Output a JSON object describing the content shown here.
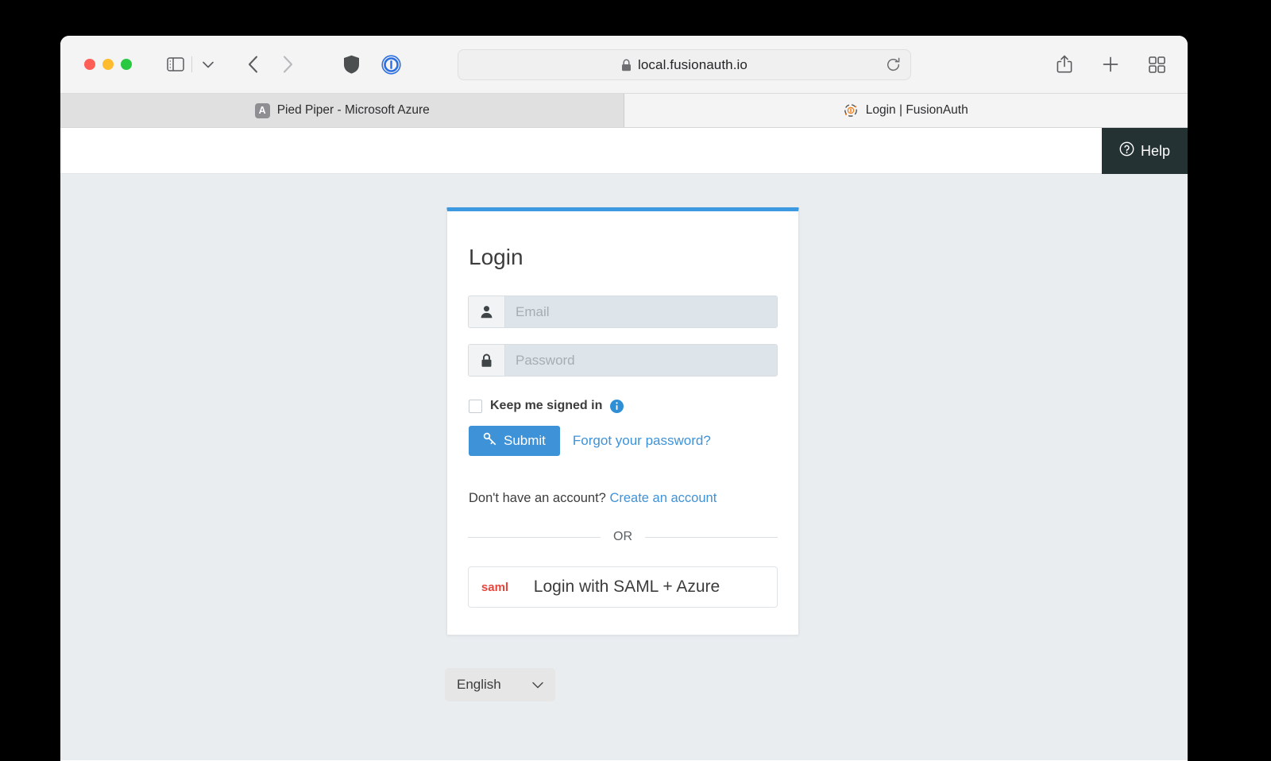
{
  "browser": {
    "url": "local.fusionauth.io",
    "lock_icon": "lock-icon",
    "reload_icon": "reload-icon",
    "sidebar_icon": "sidebar-toggle-icon",
    "chevron_icon": "chevron-down-icon",
    "back_icon": "back-arrow-icon",
    "forward_icon": "forward-arrow-icon",
    "shield_icon": "privacy-shield-icon",
    "extension_icon": "onepassword-icon",
    "share_icon": "share-icon",
    "newtab_icon": "plus-icon",
    "taboverview_icon": "tab-overview-icon",
    "tabs": [
      {
        "title": "Pied Piper - Microsoft Azure",
        "favicon": "azure-favicon",
        "favicon_letter": "A",
        "active": false
      },
      {
        "title": "Login | FusionAuth",
        "favicon": "fusionauth-favicon",
        "active": true
      }
    ]
  },
  "page": {
    "help_label": "Help",
    "help_icon": "question-circle-icon"
  },
  "login": {
    "title": "Login",
    "email": {
      "placeholder": "Email",
      "value": "",
      "icon": "user-icon"
    },
    "password": {
      "placeholder": "Password",
      "value": "",
      "icon": "lock-icon"
    },
    "keep_signed_in": {
      "label": "Keep me signed in",
      "checked": false,
      "info_icon": "info-circle-icon"
    },
    "submit_label": "Submit",
    "submit_icon": "key-icon",
    "forgot_password_label": "Forgot your password?",
    "no_account_text": "Don't have an account?",
    "create_account_label": "Create an account",
    "or_label": "OR",
    "saml": {
      "mark": "saml",
      "label": "Login with SAML + Azure"
    }
  },
  "language": {
    "selected": "English",
    "chevron_icon": "chevron-down-icon"
  },
  "colors": {
    "accent_blue": "#3e92d8",
    "card_top_border": "#3e9ae0",
    "help_dark": "#253234",
    "page_bg": "#e9edf0",
    "saml_red": "#e8453c"
  }
}
